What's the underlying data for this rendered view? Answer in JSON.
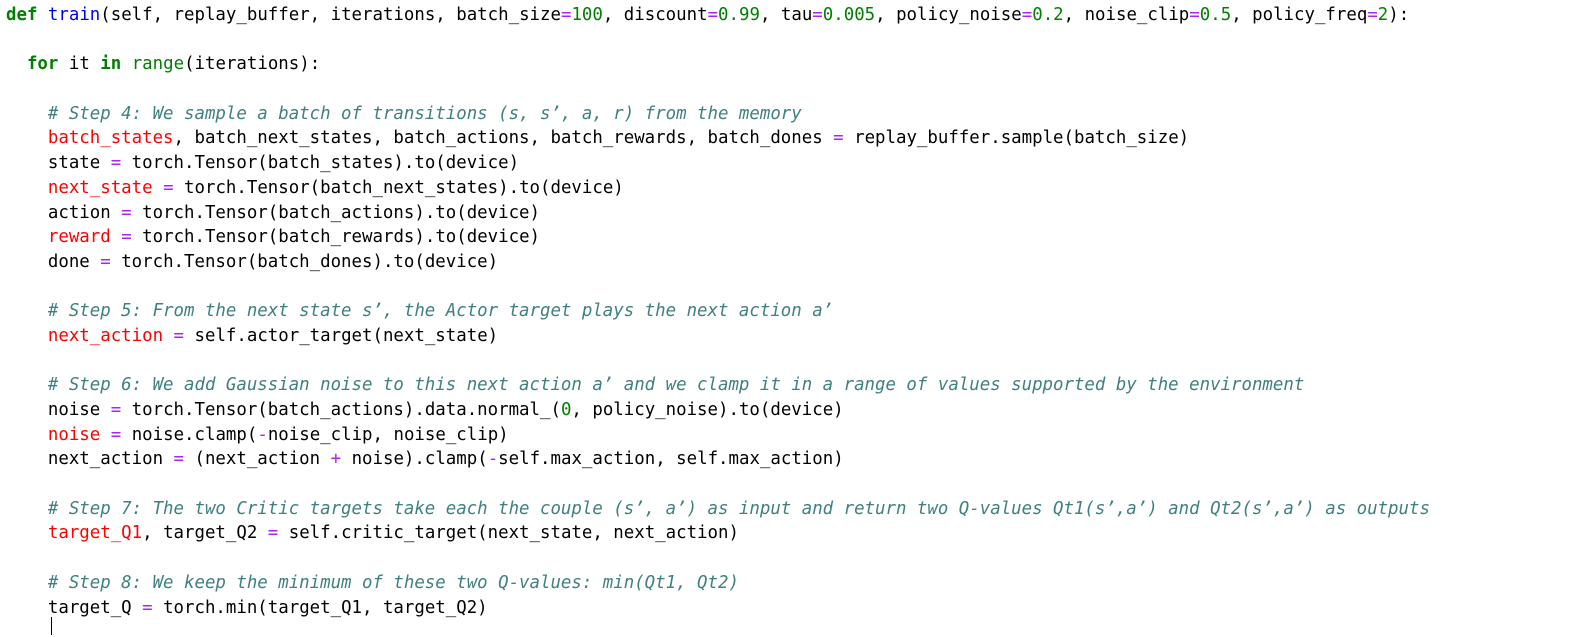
{
  "code_lines": [
    [
      {
        "t": "def",
        "c": "kw"
      },
      {
        "t": " ",
        "c": ""
      },
      {
        "t": "train",
        "c": "fn"
      },
      {
        "t": "(self, replay_buffer, iterations, batch_size",
        "c": ""
      },
      {
        "t": "=",
        "c": "op"
      },
      {
        "t": "100",
        "c": "num"
      },
      {
        "t": ", discount",
        "c": ""
      },
      {
        "t": "=",
        "c": "op"
      },
      {
        "t": "0.99",
        "c": "num"
      },
      {
        "t": ", tau",
        "c": ""
      },
      {
        "t": "=",
        "c": "op"
      },
      {
        "t": "0.005",
        "c": "num"
      },
      {
        "t": ", policy_noise",
        "c": ""
      },
      {
        "t": "=",
        "c": "op"
      },
      {
        "t": "0.2",
        "c": "num"
      },
      {
        "t": ", noise_clip",
        "c": ""
      },
      {
        "t": "=",
        "c": "op"
      },
      {
        "t": "0.5",
        "c": "num"
      },
      {
        "t": ", policy_freq",
        "c": ""
      },
      {
        "t": "=",
        "c": "op"
      },
      {
        "t": "2",
        "c": "num"
      },
      {
        "t": "):",
        "c": ""
      }
    ],
    [],
    [
      {
        "t": "  ",
        "c": ""
      },
      {
        "t": "for",
        "c": "kw"
      },
      {
        "t": " it ",
        "c": ""
      },
      {
        "t": "in",
        "c": "kw"
      },
      {
        "t": " ",
        "c": ""
      },
      {
        "t": "range",
        "c": "bi"
      },
      {
        "t": "(iterations):",
        "c": ""
      }
    ],
    [],
    [
      {
        "t": "    ",
        "c": ""
      },
      {
        "t": "# Step 4: We sample a batch of transitions (s, s’, a, r) from the memory",
        "c": "cm"
      }
    ],
    [
      {
        "t": "    ",
        "c": ""
      },
      {
        "t": "batch_states",
        "c": "hl"
      },
      {
        "t": ", batch_next_states, batch_actions, batch_rewards, batch_dones ",
        "c": ""
      },
      {
        "t": "=",
        "c": "op"
      },
      {
        "t": " replay_buffer.sample(batch_size)",
        "c": ""
      }
    ],
    [
      {
        "t": "    state ",
        "c": ""
      },
      {
        "t": "=",
        "c": "op"
      },
      {
        "t": " torch.Tensor(batch_states).to(device)",
        "c": ""
      }
    ],
    [
      {
        "t": "    ",
        "c": ""
      },
      {
        "t": "next_state",
        "c": "hl"
      },
      {
        "t": " ",
        "c": ""
      },
      {
        "t": "=",
        "c": "op"
      },
      {
        "t": " torch.Tensor(batch_next_states).to(device)",
        "c": ""
      }
    ],
    [
      {
        "t": "    action ",
        "c": ""
      },
      {
        "t": "=",
        "c": "op"
      },
      {
        "t": " torch.Tensor(batch_actions).to(device)",
        "c": ""
      }
    ],
    [
      {
        "t": "    ",
        "c": ""
      },
      {
        "t": "reward",
        "c": "hl"
      },
      {
        "t": " ",
        "c": ""
      },
      {
        "t": "=",
        "c": "op"
      },
      {
        "t": " torch.Tensor(batch_rewards).to(device)",
        "c": ""
      }
    ],
    [
      {
        "t": "    done ",
        "c": ""
      },
      {
        "t": "=",
        "c": "op"
      },
      {
        "t": " torch.Tensor(batch_dones).to(device)",
        "c": ""
      }
    ],
    [],
    [
      {
        "t": "    ",
        "c": ""
      },
      {
        "t": "# Step 5: From the next state s’, the Actor target plays the next action a’",
        "c": "cm"
      }
    ],
    [
      {
        "t": "    ",
        "c": ""
      },
      {
        "t": "next_action",
        "c": "hl"
      },
      {
        "t": " ",
        "c": ""
      },
      {
        "t": "=",
        "c": "op"
      },
      {
        "t": " self.actor_target(next_state)",
        "c": ""
      }
    ],
    [],
    [
      {
        "t": "    ",
        "c": ""
      },
      {
        "t": "# Step 6: We add Gaussian noise to this next action a’ and we clamp it in a range of values supported by the environment",
        "c": "cm"
      }
    ],
    [
      {
        "t": "    noise ",
        "c": ""
      },
      {
        "t": "=",
        "c": "op"
      },
      {
        "t": " torch.Tensor(batch_actions).data.normal_(",
        "c": ""
      },
      {
        "t": "0",
        "c": "num"
      },
      {
        "t": ", policy_noise).to(device)",
        "c": ""
      }
    ],
    [
      {
        "t": "    ",
        "c": ""
      },
      {
        "t": "noise",
        "c": "hl"
      },
      {
        "t": " ",
        "c": ""
      },
      {
        "t": "=",
        "c": "op"
      },
      {
        "t": " noise.clamp(",
        "c": ""
      },
      {
        "t": "-",
        "c": "op"
      },
      {
        "t": "noise_clip, noise_clip)",
        "c": ""
      }
    ],
    [
      {
        "t": "    next_action ",
        "c": ""
      },
      {
        "t": "=",
        "c": "op"
      },
      {
        "t": " (next_action ",
        "c": ""
      },
      {
        "t": "+",
        "c": "op"
      },
      {
        "t": " noise).clamp(",
        "c": ""
      },
      {
        "t": "-",
        "c": "op"
      },
      {
        "t": "self.max_action, self.max_action)",
        "c": ""
      }
    ],
    [],
    [
      {
        "t": "    ",
        "c": ""
      },
      {
        "t": "# Step 7: The two Critic targets take each the couple (s’, a’) as input and return two Q-values Qt1(s’,a’) and Qt2(s’,a’) as outputs",
        "c": "cm"
      }
    ],
    [
      {
        "t": "    ",
        "c": ""
      },
      {
        "t": "target_Q1",
        "c": "hl"
      },
      {
        "t": ", target_Q2 ",
        "c": ""
      },
      {
        "t": "=",
        "c": "op"
      },
      {
        "t": " self.critic_target(next_state, next_action)",
        "c": ""
      }
    ],
    [],
    [
      {
        "t": "    ",
        "c": ""
      },
      {
        "t": "# Step 8: We keep the minimum of these two Q-values: min(Qt1, Qt2)",
        "c": "cm"
      }
    ],
    [
      {
        "t": "    target_Q ",
        "c": ""
      },
      {
        "t": "=",
        "c": "op"
      },
      {
        "t": " torch.min(target_Q1, target_Q2)",
        "c": ""
      }
    ]
  ]
}
